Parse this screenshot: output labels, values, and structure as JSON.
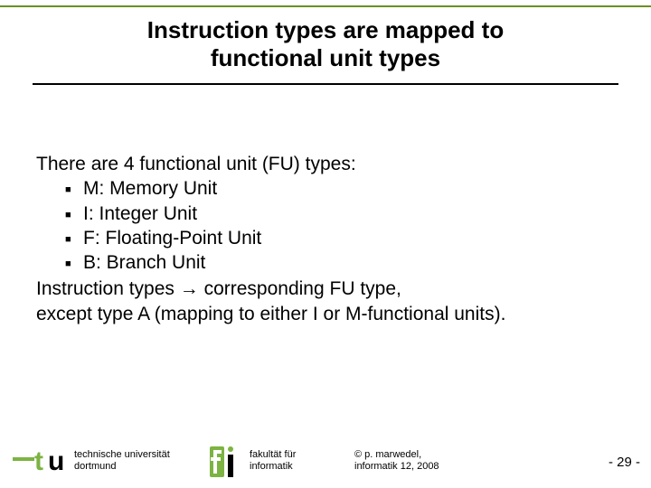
{
  "title_line1": "Instruction types are mapped to",
  "title_line2": "functional unit types",
  "content": {
    "intro": "There are 4 functional unit (FU) types:",
    "bullets": [
      "M: Memory Unit",
      "I: Integer Unit",
      "F: Floating-Point Unit",
      "B: Branch Unit"
    ],
    "outro1_pre": "Instruction types ",
    "outro1_arrow": "→",
    "outro1_post": " corresponding FU type,",
    "outro2": "except type A (mapping to either I or M-functional units)."
  },
  "footer": {
    "org1_line1": "technische universität",
    "org1_line2": "dortmund",
    "org2_line1": "fakultät für",
    "org2_line2": "informatik",
    "credit_line1": "© p. marwedel,",
    "credit_line2": "informatik 12, 2008",
    "page_prefix": "- ",
    "page_num": "29",
    "page_suffix": " -"
  }
}
